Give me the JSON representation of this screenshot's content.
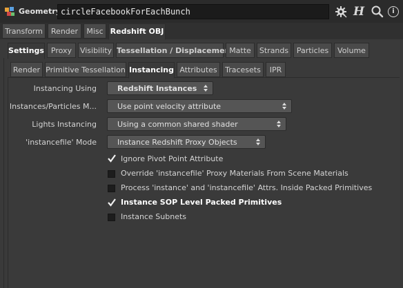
{
  "header": {
    "title": "Geometry",
    "node_name": "circleFacebookForEachBunch",
    "icons": [
      "gear-icon",
      "houdini-help-icon",
      "search-icon",
      "info-icon"
    ],
    "info_symbol": "i",
    "help_symbol": "H"
  },
  "tabs_level1": [
    {
      "label": "Transform",
      "active": false
    },
    {
      "label": "Render",
      "active": false
    },
    {
      "label": "Misc",
      "active": false
    },
    {
      "label": "Redshift OBJ",
      "active": true
    }
  ],
  "tabs_level2": [
    {
      "label": "Settings",
      "active": true
    },
    {
      "label": "Proxy",
      "active": false
    },
    {
      "label": "Visibility",
      "active": false
    },
    {
      "label": "Tessellation / Displacement",
      "active": false,
      "bold": true
    },
    {
      "label": "Matte",
      "active": false
    },
    {
      "label": "Strands",
      "active": false
    },
    {
      "label": "Particles",
      "active": false
    },
    {
      "label": "Volume",
      "active": false
    }
  ],
  "tabs_level3": [
    {
      "label": "Render",
      "active": false
    },
    {
      "label": "Primitive Tessellation",
      "active": false
    },
    {
      "label": "Instancing",
      "active": true
    },
    {
      "label": "Attributes",
      "active": false
    },
    {
      "label": "Tracesets",
      "active": false
    },
    {
      "label": "IPR",
      "active": false
    }
  ],
  "params": [
    {
      "label": "Instancing Using",
      "value": "Redshift Instances",
      "bold": true
    },
    {
      "label": "Instances/Particles M...",
      "value": "Use point velocity attribute",
      "bold": false
    },
    {
      "label": "Lights Instancing",
      "value": "Using a common shared shader",
      "bold": false
    },
    {
      "label": "'instancefile' Mode",
      "value": "Instance Redshift Proxy Objects",
      "bold": false
    }
  ],
  "toggles": [
    {
      "label": "Ignore Pivot Point Attribute",
      "checked": true
    },
    {
      "label": "Override 'instancefile' Proxy Materials From Scene Materials",
      "checked": false
    },
    {
      "label": "Process 'instance' and 'instancefile' Attrs. Inside Packed Primitives",
      "checked": false
    },
    {
      "label": "Instance SOP Level Packed Primitives",
      "checked": true
    },
    {
      "label": "Instance Subnets",
      "checked": false
    }
  ]
}
